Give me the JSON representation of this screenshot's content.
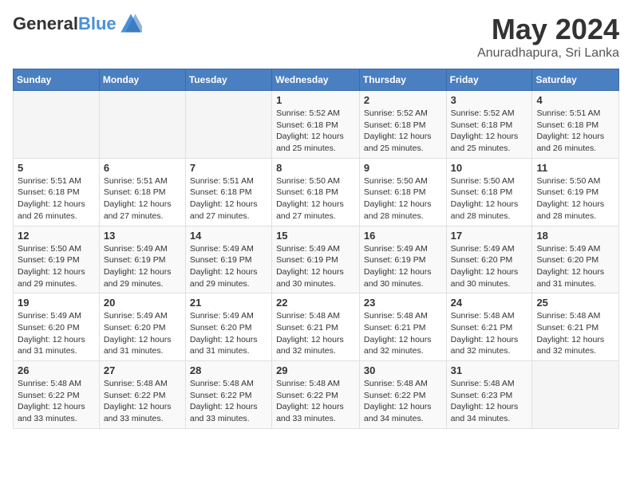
{
  "header": {
    "logo_general": "General",
    "logo_blue": "Blue",
    "month_title": "May 2024",
    "location": "Anuradhapura, Sri Lanka"
  },
  "days_of_week": [
    "Sunday",
    "Monday",
    "Tuesday",
    "Wednesday",
    "Thursday",
    "Friday",
    "Saturday"
  ],
  "weeks": [
    [
      {
        "day": "",
        "info": ""
      },
      {
        "day": "",
        "info": ""
      },
      {
        "day": "",
        "info": ""
      },
      {
        "day": "1",
        "info": "Sunrise: 5:52 AM\nSunset: 6:18 PM\nDaylight: 12 hours\nand 25 minutes."
      },
      {
        "day": "2",
        "info": "Sunrise: 5:52 AM\nSunset: 6:18 PM\nDaylight: 12 hours\nand 25 minutes."
      },
      {
        "day": "3",
        "info": "Sunrise: 5:52 AM\nSunset: 6:18 PM\nDaylight: 12 hours\nand 25 minutes."
      },
      {
        "day": "4",
        "info": "Sunrise: 5:51 AM\nSunset: 6:18 PM\nDaylight: 12 hours\nand 26 minutes."
      }
    ],
    [
      {
        "day": "5",
        "info": "Sunrise: 5:51 AM\nSunset: 6:18 PM\nDaylight: 12 hours\nand 26 minutes."
      },
      {
        "day": "6",
        "info": "Sunrise: 5:51 AM\nSunset: 6:18 PM\nDaylight: 12 hours\nand 27 minutes."
      },
      {
        "day": "7",
        "info": "Sunrise: 5:51 AM\nSunset: 6:18 PM\nDaylight: 12 hours\nand 27 minutes."
      },
      {
        "day": "8",
        "info": "Sunrise: 5:50 AM\nSunset: 6:18 PM\nDaylight: 12 hours\nand 27 minutes."
      },
      {
        "day": "9",
        "info": "Sunrise: 5:50 AM\nSunset: 6:18 PM\nDaylight: 12 hours\nand 28 minutes."
      },
      {
        "day": "10",
        "info": "Sunrise: 5:50 AM\nSunset: 6:18 PM\nDaylight: 12 hours\nand 28 minutes."
      },
      {
        "day": "11",
        "info": "Sunrise: 5:50 AM\nSunset: 6:19 PM\nDaylight: 12 hours\nand 28 minutes."
      }
    ],
    [
      {
        "day": "12",
        "info": "Sunrise: 5:50 AM\nSunset: 6:19 PM\nDaylight: 12 hours\nand 29 minutes."
      },
      {
        "day": "13",
        "info": "Sunrise: 5:49 AM\nSunset: 6:19 PM\nDaylight: 12 hours\nand 29 minutes."
      },
      {
        "day": "14",
        "info": "Sunrise: 5:49 AM\nSunset: 6:19 PM\nDaylight: 12 hours\nand 29 minutes."
      },
      {
        "day": "15",
        "info": "Sunrise: 5:49 AM\nSunset: 6:19 PM\nDaylight: 12 hours\nand 30 minutes."
      },
      {
        "day": "16",
        "info": "Sunrise: 5:49 AM\nSunset: 6:19 PM\nDaylight: 12 hours\nand 30 minutes."
      },
      {
        "day": "17",
        "info": "Sunrise: 5:49 AM\nSunset: 6:20 PM\nDaylight: 12 hours\nand 30 minutes."
      },
      {
        "day": "18",
        "info": "Sunrise: 5:49 AM\nSunset: 6:20 PM\nDaylight: 12 hours\nand 31 minutes."
      }
    ],
    [
      {
        "day": "19",
        "info": "Sunrise: 5:49 AM\nSunset: 6:20 PM\nDaylight: 12 hours\nand 31 minutes."
      },
      {
        "day": "20",
        "info": "Sunrise: 5:49 AM\nSunset: 6:20 PM\nDaylight: 12 hours\nand 31 minutes."
      },
      {
        "day": "21",
        "info": "Sunrise: 5:49 AM\nSunset: 6:20 PM\nDaylight: 12 hours\nand 31 minutes."
      },
      {
        "day": "22",
        "info": "Sunrise: 5:48 AM\nSunset: 6:21 PM\nDaylight: 12 hours\nand 32 minutes."
      },
      {
        "day": "23",
        "info": "Sunrise: 5:48 AM\nSunset: 6:21 PM\nDaylight: 12 hours\nand 32 minutes."
      },
      {
        "day": "24",
        "info": "Sunrise: 5:48 AM\nSunset: 6:21 PM\nDaylight: 12 hours\nand 32 minutes."
      },
      {
        "day": "25",
        "info": "Sunrise: 5:48 AM\nSunset: 6:21 PM\nDaylight: 12 hours\nand 32 minutes."
      }
    ],
    [
      {
        "day": "26",
        "info": "Sunrise: 5:48 AM\nSunset: 6:22 PM\nDaylight: 12 hours\nand 33 minutes."
      },
      {
        "day": "27",
        "info": "Sunrise: 5:48 AM\nSunset: 6:22 PM\nDaylight: 12 hours\nand 33 minutes."
      },
      {
        "day": "28",
        "info": "Sunrise: 5:48 AM\nSunset: 6:22 PM\nDaylight: 12 hours\nand 33 minutes."
      },
      {
        "day": "29",
        "info": "Sunrise: 5:48 AM\nSunset: 6:22 PM\nDaylight: 12 hours\nand 33 minutes."
      },
      {
        "day": "30",
        "info": "Sunrise: 5:48 AM\nSunset: 6:22 PM\nDaylight: 12 hours\nand 34 minutes."
      },
      {
        "day": "31",
        "info": "Sunrise: 5:48 AM\nSunset: 6:23 PM\nDaylight: 12 hours\nand 34 minutes."
      },
      {
        "day": "",
        "info": ""
      }
    ]
  ]
}
